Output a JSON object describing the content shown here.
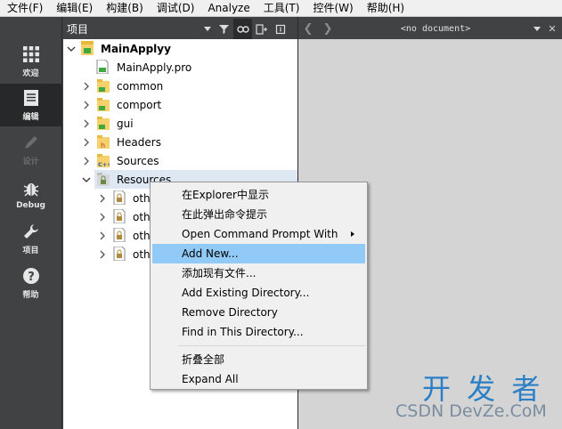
{
  "menubar": {
    "items": [
      "文件(F)",
      "编辑(E)",
      "构建(B)",
      "调试(D)",
      "Analyze",
      "工具(T)",
      "控件(W)",
      "帮助(H)"
    ]
  },
  "modebar": {
    "modes": [
      {
        "label": "欢迎",
        "icon": "grid-icon",
        "active": false,
        "enabled": true
      },
      {
        "label": "编辑",
        "icon": "document-icon",
        "active": true,
        "enabled": true
      },
      {
        "label": "设计",
        "icon": "pencil-icon",
        "active": false,
        "enabled": false
      },
      {
        "label": "Debug",
        "icon": "bug-icon",
        "active": false,
        "enabled": true
      },
      {
        "label": "项目",
        "icon": "wrench-icon",
        "active": false,
        "enabled": true
      },
      {
        "label": "帮助",
        "icon": "help-icon",
        "active": false,
        "enabled": true
      }
    ]
  },
  "project_toolbar": {
    "view_selector": "项目"
  },
  "editor_toolbar": {
    "document": "<no document>"
  },
  "tree": {
    "rows": [
      {
        "label": "MainApplyy",
        "icon": "qt-project-icon",
        "expanded": true,
        "bold": true
      },
      {
        "label": "MainApply.pro",
        "icon": "pro-file-icon",
        "expanded": null
      },
      {
        "label": "common",
        "icon": "folder-qt-icon",
        "expanded": false
      },
      {
        "label": "comport",
        "icon": "folder-qt-icon",
        "expanded": false
      },
      {
        "label": "gui",
        "icon": "folder-qt-icon",
        "expanded": false
      },
      {
        "label": "Headers",
        "icon": "folder-header-icon",
        "expanded": false
      },
      {
        "label": "Sources",
        "icon": "folder-cpp-icon",
        "expanded": false
      },
      {
        "label": "Resources",
        "icon": "folder-lock-icon",
        "expanded": true,
        "selected": true
      },
      {
        "label": "oth",
        "icon": "lock-file-icon",
        "expanded": false
      },
      {
        "label": "oth",
        "icon": "lock-file-icon",
        "expanded": false
      },
      {
        "label": "oth",
        "icon": "lock-file-icon",
        "expanded": false
      },
      {
        "label": "oth",
        "icon": "lock-file-icon",
        "expanded": false
      }
    ]
  },
  "context_menu": {
    "items": [
      {
        "label": "在Explorer中显示"
      },
      {
        "label": "在此弹出命令提示"
      },
      {
        "label": "Open Command Prompt With",
        "submenu": true
      },
      {
        "label": "Add New...",
        "highlighted": true
      },
      {
        "label": "添加现有文件..."
      },
      {
        "label": "Add Existing Directory..."
      },
      {
        "label": "Remove Directory"
      },
      {
        "label": "Find in This Directory..."
      },
      {
        "label": "折叠全部"
      },
      {
        "label": "Expand All"
      }
    ]
  },
  "watermark": {
    "big": "开 发 者",
    "small": "CSDN DevZe.CoM"
  },
  "colors": {
    "sidebar": "#404244",
    "active_mode": "#272829",
    "selection": "#dde8f3",
    "menu_highlight": "#91c9f7",
    "watermark": "#2b7fc6"
  }
}
